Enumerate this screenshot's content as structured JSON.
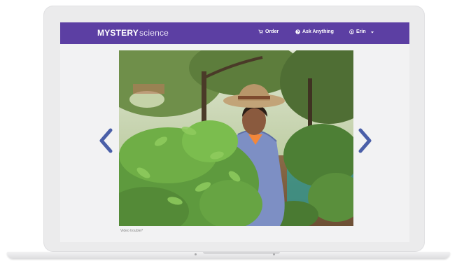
{
  "brand": {
    "bold": "MYSTERY",
    "light": "science"
  },
  "nav": {
    "order_label": "Order",
    "ask_label": "Ask Anything",
    "user_label": "Erin",
    "order_icon": "cart-icon",
    "ask_icon": "question-circle-icon",
    "user_icon": "user-circle-icon",
    "dropdown_icon": "caret-down-icon"
  },
  "media": {
    "prev_icon": "chevron-left-icon",
    "next_icon": "chevron-right-icon",
    "video_trouble_label": "Video trouble?"
  },
  "colors": {
    "nav_bg": "#5c3fa3",
    "arrow": "#4a5fa8",
    "page_bg": "#f2f2f3"
  }
}
